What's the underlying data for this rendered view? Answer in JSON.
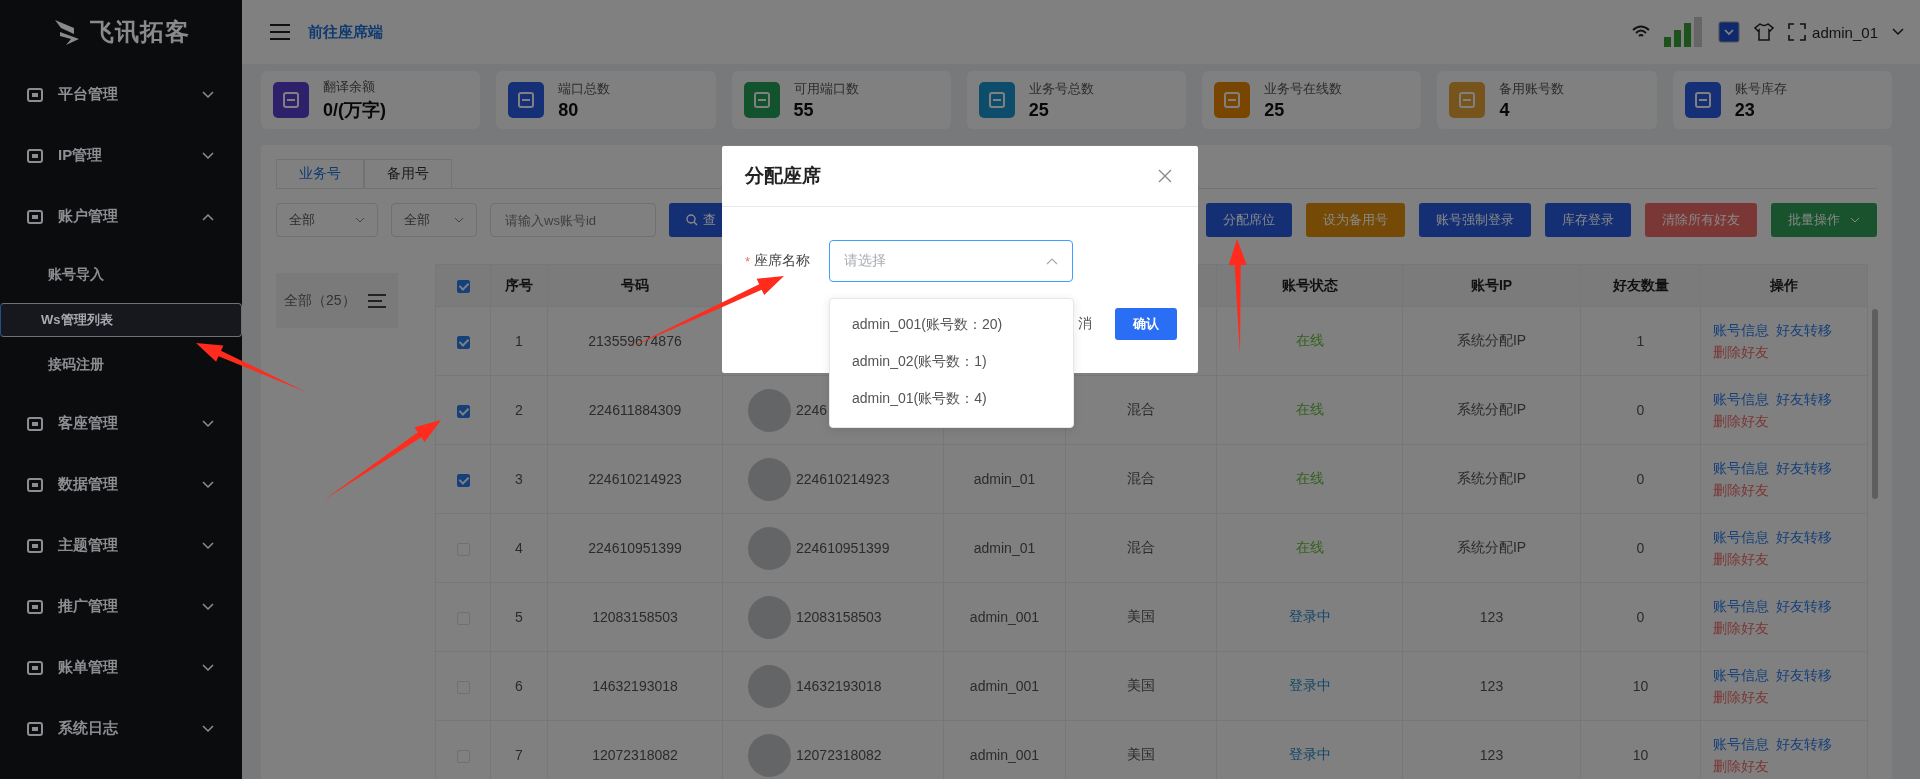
{
  "sidebar": {
    "logo": "飞讯拓客",
    "items": [
      {
        "label": "平台管理",
        "selected": false,
        "expanded": false
      },
      {
        "label": "IP管理",
        "selected": false,
        "expanded": false
      },
      {
        "label": "账户管理",
        "selected": false,
        "expanded": true,
        "children": [
          {
            "label": "账号导入",
            "selected": false
          },
          {
            "label": "Ws管理列表",
            "selected": true
          },
          {
            "label": "接码注册",
            "selected": false
          }
        ]
      },
      {
        "label": "客座管理",
        "selected": false,
        "expanded": false
      },
      {
        "label": "数据管理",
        "selected": false,
        "expanded": false
      },
      {
        "label": "主题管理",
        "selected": false,
        "expanded": false
      },
      {
        "label": "推广管理",
        "selected": false,
        "expanded": false
      },
      {
        "label": "账单管理",
        "selected": false,
        "expanded": false
      },
      {
        "label": "系统日志",
        "selected": false,
        "expanded": false
      }
    ]
  },
  "header": {
    "link": "前往座席端",
    "user": "admin_01"
  },
  "stats": [
    {
      "label": "翻译余额",
      "value": "0/(万字)",
      "color": "#2e206b"
    },
    {
      "label": "端口总数",
      "value": "80",
      "color": "#163078"
    },
    {
      "label": "可用端口数",
      "value": "55",
      "color": "#12522d"
    },
    {
      "label": "业务号总数",
      "value": "25",
      "color": "#0d4d6b"
    },
    {
      "label": "业务号在线数",
      "value": "25",
      "color": "#784600"
    },
    {
      "label": "备用账号数",
      "value": "4",
      "color": "#78541d"
    },
    {
      "label": "账号库存",
      "value": "23",
      "color": "#163078"
    }
  ],
  "tabs": [
    {
      "label": "业务号",
      "selected": true
    },
    {
      "label": "备用号",
      "selected": false
    }
  ],
  "filters": {
    "select_1": "全部",
    "select_2": "全部",
    "search": {
      "placeholder": "请输入ws账号id"
    },
    "search_button": "查"
  },
  "actions": [
    {
      "label": "分配席位",
      "kind": "primary"
    },
    {
      "label": "设为备用号",
      "kind": "warning"
    },
    {
      "label": "账号强制登录",
      "kind": "primary"
    },
    {
      "label": "库存登录",
      "kind": "primary"
    },
    {
      "label": "清除所有好友",
      "kind": "danger"
    },
    {
      "label": "批量操作",
      "kind": "dropdown"
    }
  ],
  "group": {
    "label": "全部（25）"
  },
  "table": {
    "select_all": true,
    "columns": [
      "序号",
      "号码",
      null,
      null,
      null,
      "账号状态",
      "账号IP",
      "好友数量",
      "操作"
    ],
    "rows": [
      {
        "checked": true,
        "index": "1",
        "number": "213559674876",
        "status": {
          "label": "在线",
          "color": "#34611d"
        },
        "ip": "系统分配IP",
        "friends": "1",
        "links": [
          {
            "label": "账号信息",
            "kind": "link"
          },
          {
            "label": "好友转移",
            "kind": "link"
          },
          {
            "label": "删除好友",
            "kind": "danger"
          }
        ]
      },
      {
        "checked": true,
        "index": "2",
        "number": "224611884309",
        "name": "2246",
        "type": "混合",
        "status": {
          "label": "在线",
          "color": "#34611d"
        },
        "ip": "系统分配IP",
        "friends": "0",
        "links": [
          {
            "label": "账号信息",
            "kind": "link"
          },
          {
            "label": "好友转移",
            "kind": "link"
          },
          {
            "label": "删除好友",
            "kind": "danger"
          }
        ]
      },
      {
        "checked": true,
        "index": "3",
        "number": "224610214923",
        "name": "224610214923",
        "seat": "admin_01",
        "type": "混合",
        "status": {
          "label": "在线",
          "color": "#34611d"
        },
        "ip": "系统分配IP",
        "friends": "0",
        "links": [
          {
            "label": "账号信息",
            "kind": "link"
          },
          {
            "label": "好友转移",
            "kind": "link"
          },
          {
            "label": "删除好友",
            "kind": "danger"
          }
        ]
      },
      {
        "checked": false,
        "index": "4",
        "number": "224610951399",
        "name": "224610951399",
        "seat": "admin_01",
        "type": "混合",
        "status": {
          "label": "在线",
          "color": "#34611d"
        },
        "ip": "系统分配IP",
        "friends": "0",
        "links": [
          {
            "label": "账号信息",
            "kind": "link"
          },
          {
            "label": "好友转移",
            "kind": "link"
          },
          {
            "label": "删除好友",
            "kind": "danger"
          }
        ]
      },
      {
        "checked": false,
        "index": "5",
        "number": "12083158503",
        "name": "12083158503",
        "seat": "admin_001",
        "type": "美国",
        "status": {
          "label": "登录中",
          "color": "#104568"
        },
        "ip": "123",
        "friends": "0",
        "links": [
          {
            "label": "账号信息",
            "kind": "link"
          },
          {
            "label": "好友转移",
            "kind": "link"
          },
          {
            "label": "删除好友",
            "kind": "danger"
          }
        ]
      },
      {
        "checked": false,
        "index": "6",
        "number": "14632193018",
        "name": "14632193018",
        "seat": "admin_001",
        "type": "美国",
        "status": {
          "label": "登录中",
          "color": "#104568"
        },
        "ip": "123",
        "friends": "10",
        "links": [
          {
            "label": "账号信息",
            "kind": "link"
          },
          {
            "label": "好友转移",
            "kind": "link"
          },
          {
            "label": "删除好友",
            "kind": "danger"
          }
        ]
      },
      {
        "checked": false,
        "index": "7",
        "number": "12072318082",
        "name": "12072318082",
        "seat": "admin_001",
        "type": "美国",
        "status": {
          "label": "登录中",
          "color": "#104568"
        },
        "ip": "123",
        "friends": "10",
        "links": [
          {
            "label": "账号信息",
            "kind": "link"
          },
          {
            "label": "好友转移",
            "kind": "link"
          },
          {
            "label": "删除好友",
            "kind": "danger"
          }
        ]
      }
    ]
  },
  "dialog": {
    "title": "分配座席",
    "required_mark": "*",
    "field_label": "座席名称",
    "select": {
      "placeholder": "请选择"
    },
    "options": [
      {
        "label": "admin_001(账号数：20)",
        "selected": false
      },
      {
        "label": "admin_02(账号数：1)",
        "selected": false
      },
      {
        "label": "admin_01(账号数：4)",
        "selected": false
      }
    ],
    "cancel": "消",
    "confirm": "确认"
  }
}
